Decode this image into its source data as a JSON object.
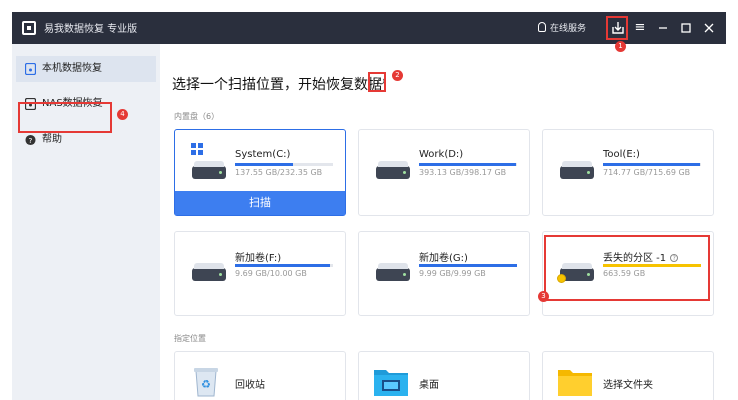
{
  "app": {
    "title": "易我数据恢复 专业版",
    "online_service": "在线服务"
  },
  "window_controls": [
    "export-icon",
    "menu-icon",
    "minimize-icon",
    "maximize-icon",
    "close-icon"
  ],
  "annotations": [
    "1",
    "2",
    "3",
    "4"
  ],
  "sidebar": {
    "items": [
      {
        "label": "本机数据恢复",
        "icon": "computer-icon"
      },
      {
        "label": "NAS数据恢复",
        "icon": "nas-icon"
      },
      {
        "label": "帮助",
        "icon": "help-icon"
      }
    ]
  },
  "main": {
    "heading": "选择一个扫描位置，开始恢复数据",
    "internal_label": "内置盘（6）",
    "specified_label": "指定位置",
    "scan_button": "扫描",
    "drives": [
      {
        "name": "System(C:)",
        "size": "137.55 GB/232.35 GB",
        "usage": 0.59
      },
      {
        "name": "Work(D:)",
        "size": "393.13 GB/398.17 GB",
        "usage": 0.99
      },
      {
        "name": "Tool(E:)",
        "size": "714.77 GB/715.69 GB",
        "usage": 0.99
      },
      {
        "name": "新加卷(F:)",
        "size": "9.69 GB/10.00 GB",
        "usage": 0.97
      },
      {
        "name": "新加卷(G:)",
        "size": "9.99 GB/9.99 GB",
        "usage": 1.0
      },
      {
        "name": "丢失的分区 -1",
        "size": "663.59 GB",
        "usage": 1.0
      }
    ],
    "locations": [
      {
        "label": "回收站",
        "icon": "recycle-bin-icon"
      },
      {
        "label": "桌面",
        "icon": "desktop-folder-icon"
      },
      {
        "label": "选择文件夹",
        "icon": "folder-icon"
      }
    ]
  },
  "colors": {
    "titlebar": "#2a2f3d",
    "accent": "#2d6ee6",
    "annotation": "#e53935",
    "lost_partition": "#f7c300"
  }
}
